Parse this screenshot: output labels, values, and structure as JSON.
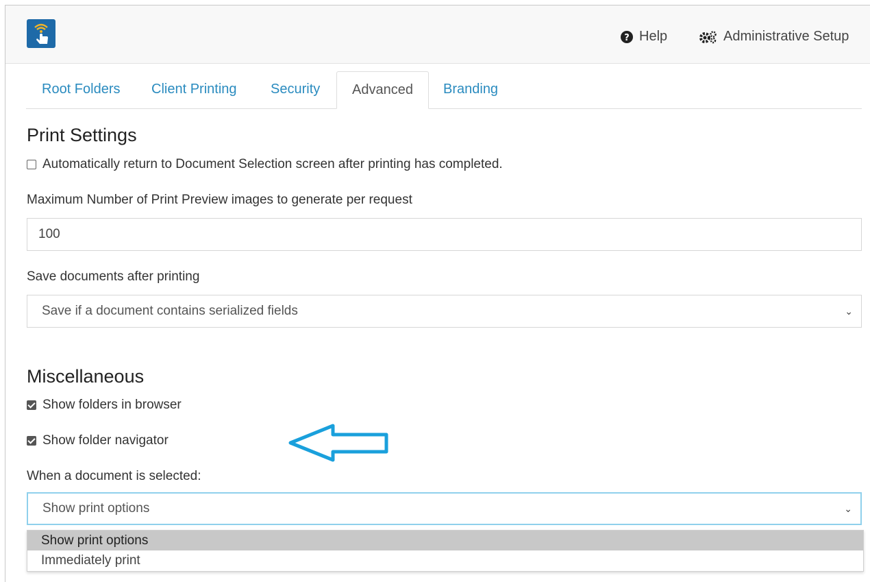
{
  "header": {
    "help_label": "Help",
    "admin_label": "Administrative Setup"
  },
  "tabs": [
    {
      "label": "Root Folders"
    },
    {
      "label": "Client Printing"
    },
    {
      "label": "Security"
    },
    {
      "label": "Advanced"
    },
    {
      "label": "Branding"
    }
  ],
  "print_settings": {
    "title": "Print Settings",
    "auto_return_label": "Automatically return to Document Selection screen after printing has completed.",
    "max_preview_label": "Maximum Number of Print Preview images to generate per request",
    "max_preview_value": "100",
    "save_docs_label": "Save documents after printing",
    "save_docs_value": "Save if a document contains serialized fields"
  },
  "misc": {
    "title": "Miscellaneous",
    "show_folders_label": "Show folders in browser",
    "show_navigator_label": "Show folder navigator",
    "doc_selected_label": "When a document is selected:",
    "doc_selected_value": "Show print options",
    "options": [
      "Show print options",
      "Immediately print"
    ]
  },
  "colors": {
    "accent": "#2a8bbf",
    "arrow": "#1aa0dc",
    "logo": "#1e6aa8"
  }
}
